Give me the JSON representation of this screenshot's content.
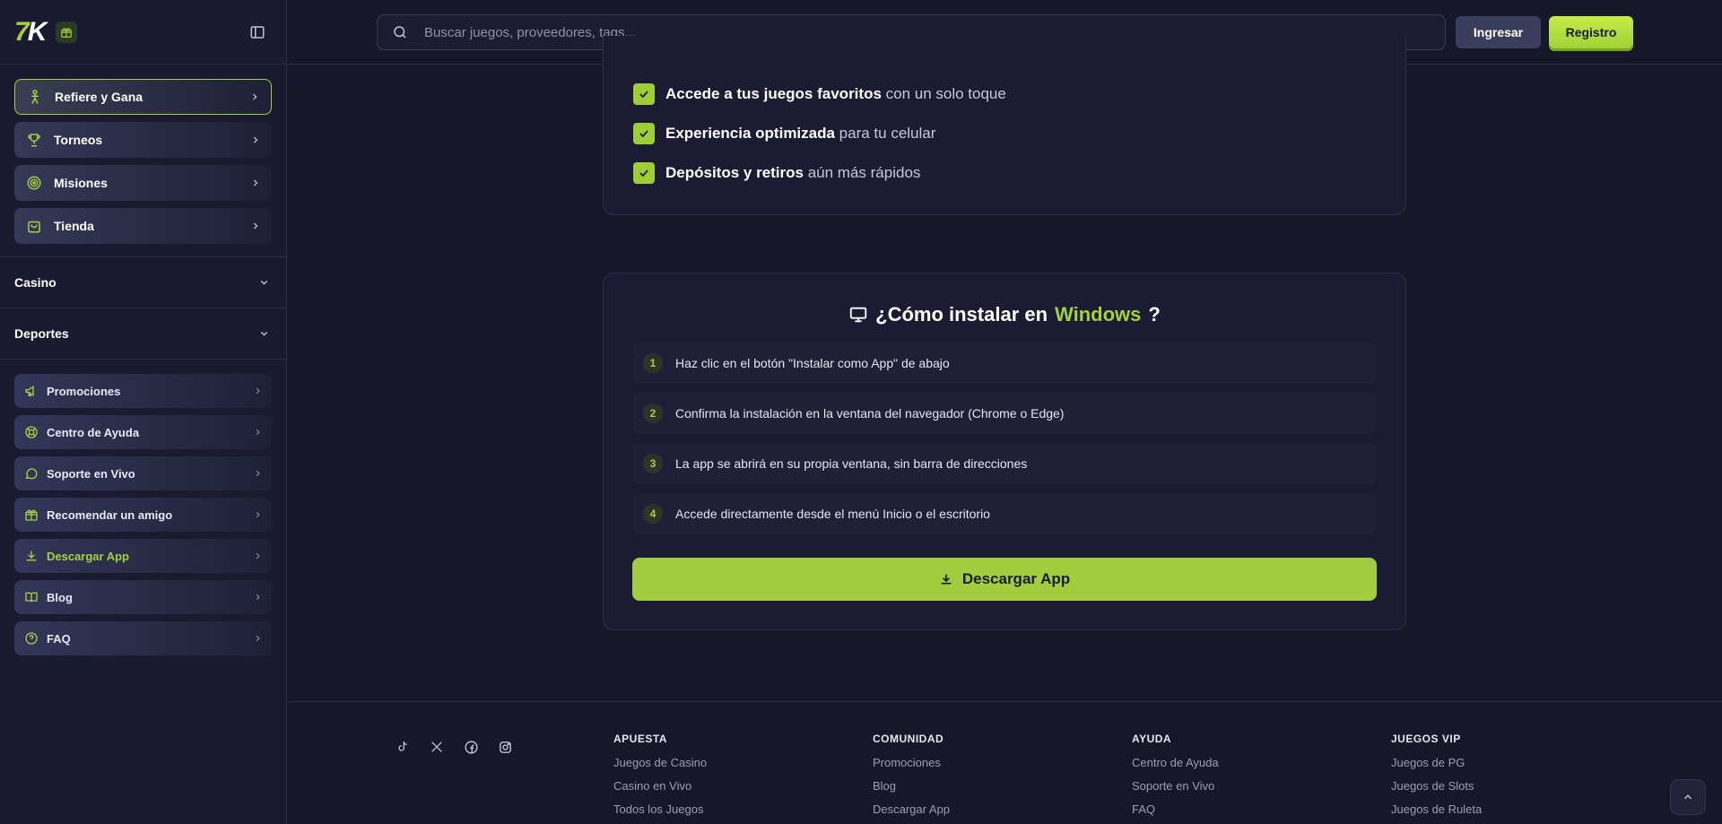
{
  "brand": {
    "logo_seven": "7",
    "logo_k": "K"
  },
  "header": {
    "search_placeholder": "Buscar juegos, proveedores, tags...",
    "login_label": "Ingresar",
    "register_label": "Registro"
  },
  "sidebar": {
    "featured": [
      {
        "label": "Refiere y Gana",
        "icon": "referral-icon"
      },
      {
        "label": "Torneos",
        "icon": "trophy-icon"
      },
      {
        "label": "Misiones",
        "icon": "target-icon"
      },
      {
        "label": "Tienda",
        "icon": "shopping-bag-icon"
      }
    ],
    "sections": [
      {
        "label": "Casino"
      },
      {
        "label": "Deportes"
      }
    ],
    "links": [
      {
        "label": "Promociones",
        "icon": "megaphone-icon"
      },
      {
        "label": "Centro de Ayuda",
        "icon": "lifebuoy-icon"
      },
      {
        "label": "Soporte en Vivo",
        "icon": "chat-bubble-icon"
      },
      {
        "label": "Recomendar un amigo",
        "icon": "gift-icon"
      },
      {
        "label": "Descargar App",
        "icon": "download-icon"
      },
      {
        "label": "Blog",
        "icon": "book-icon"
      },
      {
        "label": "FAQ",
        "icon": "question-circle-icon"
      }
    ]
  },
  "benefits": [
    {
      "bold": "Accede a tus juegos favoritos",
      "rest": " con un solo toque"
    },
    {
      "bold": "Experiencia optimizada",
      "rest": " para tu celular"
    },
    {
      "bold": "Depósitos y retiros",
      "rest": " aún más rápidos"
    }
  ],
  "install": {
    "title_prefix": "¿Cómo instalar en",
    "title_platform": "Windows",
    "title_suffix": "?",
    "steps": [
      {
        "num": "1",
        "text": "Haz clic en el botón \"Instalar como App\" de abajo"
      },
      {
        "num": "2",
        "text": "Confirma la instalación en la ventana del navegador (Chrome o Edge)"
      },
      {
        "num": "3",
        "text": "La app se abrirá en su propia ventana, sin barra de direcciones"
      },
      {
        "num": "4",
        "text": "Accede directamente desde el menú Inicio o el escritorio"
      }
    ],
    "button_label": "Descargar App"
  },
  "footer": {
    "socials": [
      "tiktok-icon",
      "x-icon",
      "facebook-icon",
      "instagram-icon"
    ],
    "columns": [
      {
        "title": "APUESTA",
        "links": [
          "Juegos de Casino",
          "Casino en Vivo",
          "Todos los Juegos"
        ]
      },
      {
        "title": "COMUNIDAD",
        "links": [
          "Promociones",
          "Blog",
          "Descargar App"
        ]
      },
      {
        "title": "AYUDA",
        "links": [
          "Centro de Ayuda",
          "Soporte en Vivo",
          "FAQ"
        ]
      },
      {
        "title": "JUEGOS VIP",
        "links": [
          "Juegos de PG",
          "Juegos de Slots",
          "Juegos de Ruleta"
        ]
      }
    ]
  },
  "colors": {
    "accent": "#a3d33c",
    "background": "#161729",
    "sidebar": "#1a1b30"
  }
}
